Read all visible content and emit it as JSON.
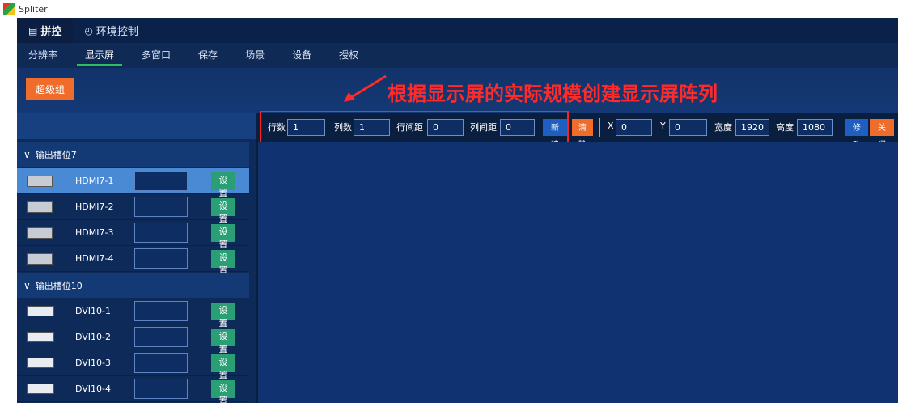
{
  "window": {
    "title": "Spliter"
  },
  "main_tabs": [
    {
      "label": "拼控",
      "icon": "grid-icon",
      "active": true
    },
    {
      "label": "环境控制",
      "icon": "gauge-icon",
      "active": false
    }
  ],
  "sub_tabs": [
    {
      "label": "分辨率",
      "active": false
    },
    {
      "label": "显示屏",
      "active": true
    },
    {
      "label": "多窗口",
      "active": false
    },
    {
      "label": "保存",
      "active": false
    },
    {
      "label": "场景",
      "active": false
    },
    {
      "label": "设备",
      "active": false
    },
    {
      "label": "授权",
      "active": false
    }
  ],
  "banner": {
    "super_group_label": "超级组"
  },
  "annotation": "根据显示屏的实际规模创建显示屏阵列",
  "sidebar": {
    "groups": [
      {
        "label": "输出槽位7",
        "items": [
          {
            "name": "HDMI7-1",
            "type": "hdmi",
            "selected": true,
            "set_label": "设置"
          },
          {
            "name": "HDMI7-2",
            "type": "hdmi",
            "selected": false,
            "set_label": "设置"
          },
          {
            "name": "HDMI7-3",
            "type": "hdmi",
            "selected": false,
            "set_label": "设置"
          },
          {
            "name": "HDMI7-4",
            "type": "hdmi",
            "selected": false,
            "set_label": "设置"
          }
        ]
      },
      {
        "label": "输出槽位10",
        "items": [
          {
            "name": "DVI10-1",
            "type": "dvi",
            "selected": false,
            "set_label": "设置"
          },
          {
            "name": "DVI10-2",
            "type": "dvi",
            "selected": false,
            "set_label": "设置"
          },
          {
            "name": "DVI10-3",
            "type": "dvi",
            "selected": false,
            "set_label": "设置"
          },
          {
            "name": "DVI10-4",
            "type": "dvi",
            "selected": false,
            "set_label": "设置"
          }
        ]
      }
    ]
  },
  "toolbar": {
    "rows_label": "行数",
    "rows_value": "1",
    "cols_label": "列数",
    "cols_value": "1",
    "row_gap_label": "行间距",
    "row_gap_value": "0",
    "col_gap_label": "列间距",
    "col_gap_value": "0",
    "new_label": "新建",
    "clear_label": "清除",
    "x_label": "X",
    "x_value": "0",
    "y_label": "Y",
    "y_value": "0",
    "width_label": "宽度",
    "width_value": "1920",
    "height_label": "高度",
    "height_value": "1080",
    "modify_label": "修改",
    "close_label": "关闭"
  },
  "colors": {
    "accent_orange": "#f06c2b",
    "set_green": "#2a9f75",
    "new_blue": "#1f5fbf",
    "annotation_red": "#ff2a2a"
  }
}
